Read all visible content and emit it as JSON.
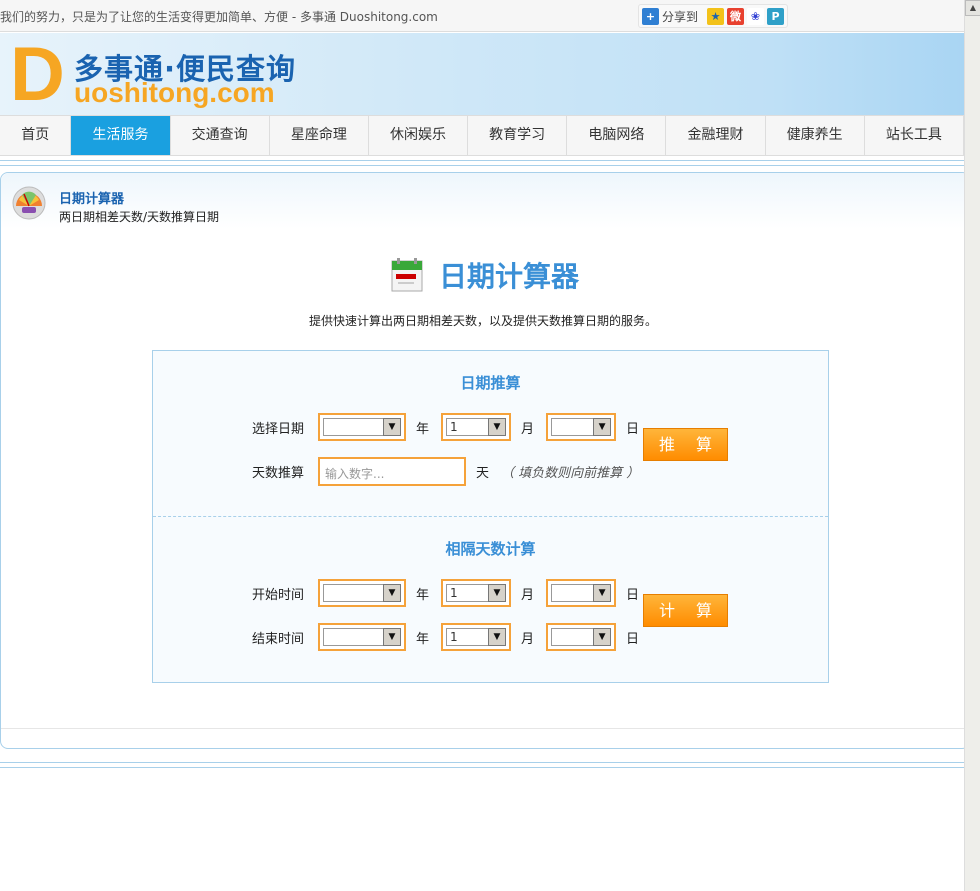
{
  "topbar": {
    "slogan": "我们的努力，只是为了让您的生活变得更加简单、方便 - 多事通 Duoshitong.com",
    "share_label": "分享到",
    "share_icons": [
      "qzone-icon",
      "weibo-icon",
      "baidu-icon",
      "pengyou-icon"
    ]
  },
  "logo": {
    "letter": "D",
    "cn": "多事通·便民查询",
    "en": "uoshitong.com"
  },
  "nav": [
    {
      "label": "首页"
    },
    {
      "label": "生活服务"
    },
    {
      "label": "交通查询"
    },
    {
      "label": "星座命理"
    },
    {
      "label": "休闲娱乐"
    },
    {
      "label": "教育学习"
    },
    {
      "label": "电脑网络"
    },
    {
      "label": "金融理财"
    },
    {
      "label": "健康养生"
    },
    {
      "label": "站长工具"
    }
  ],
  "nav_active": "生活服务",
  "panel": {
    "title": "日期计算器",
    "subtitle": "两日期相差天数/天数推算日期"
  },
  "main": {
    "title": "日期计算器",
    "description": "提供快速计算出两日期相差天数，以及提供天数推算日期的服务。"
  },
  "infer": {
    "title": "日期推算",
    "date_label": "选择日期",
    "year_unit": "年",
    "month_unit": "月",
    "day_unit": "日",
    "year_value": "",
    "month_value": "1",
    "day_value": "",
    "days_label": "天数推算",
    "days_placeholder": "输入数字...",
    "days_unit": "天",
    "hint": "（ 填负数则向前推算 ）",
    "button": "推 算"
  },
  "diff": {
    "title": "相隔天数计算",
    "start_label": "开始时间",
    "end_label": "结束时间",
    "year_unit": "年",
    "month_unit": "月",
    "day_unit": "日",
    "start_month": "1",
    "end_month": "1",
    "button": "计 算"
  },
  "colors": {
    "accent": "#1aa0e0",
    "title_blue": "#3a8fd6",
    "orange": "#f5a23a"
  }
}
